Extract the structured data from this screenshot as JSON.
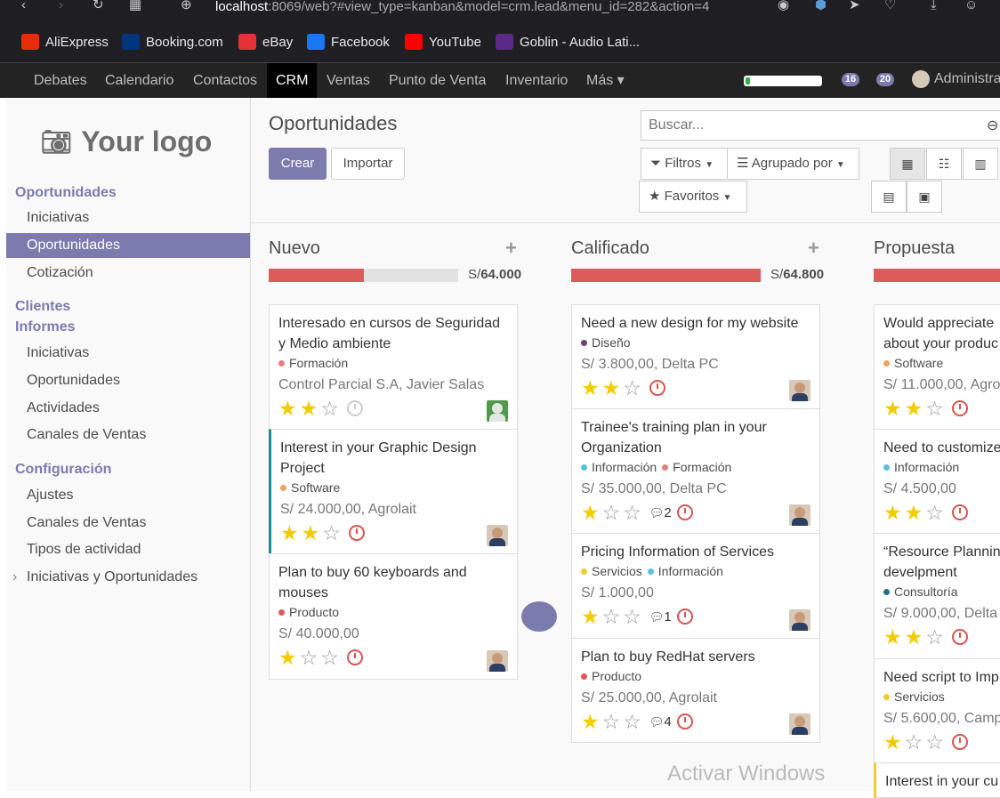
{
  "browser": {
    "url_host": "localhost",
    "url_rest": ":8069/web?#view_type=kanban&model=crm.lead&menu_id=282&action=4",
    "bookmarks": [
      {
        "label": "AliExpress",
        "icon": "aliexpress-icon",
        "color": "#e62e04"
      },
      {
        "label": "Booking.com",
        "icon": "booking-icon",
        "color": "#003580"
      },
      {
        "label": "eBay",
        "icon": "ebay-icon",
        "color": "#e53238"
      },
      {
        "label": "Facebook",
        "icon": "facebook-icon",
        "color": "#1877f2"
      },
      {
        "label": "YouTube",
        "icon": "youtube-icon",
        "color": "#ff0000"
      },
      {
        "label": "Goblin - Audio Lati...",
        "icon": "goblin-icon",
        "color": "#5b2a86"
      }
    ]
  },
  "topbar": {
    "menu": [
      "Debates",
      "Calendario",
      "Contactos",
      "CRM",
      "Ventas",
      "Punto de Venta",
      "Inventario",
      "Más"
    ],
    "active": "CRM",
    "progress": 0.06,
    "badge_activities": "16",
    "badge_messages": "20",
    "user": "Administra"
  },
  "sidebar": {
    "logo_text": "Your logo",
    "sections": [
      {
        "heading": "Oportunidades",
        "items": [
          "Iniciativas",
          "Oportunidades",
          "Cotización"
        ]
      },
      {
        "heading": "Clientes",
        "items": []
      },
      {
        "heading": "Informes",
        "items": [
          "Iniciativas",
          "Oportunidades",
          "Actividades",
          "Canales de Ventas"
        ]
      },
      {
        "heading": "Configuración",
        "items": [
          "Ajustes",
          "Canales de Ventas",
          "Tipos de actividad",
          "Iniciativas y Oportunidades"
        ]
      }
    ],
    "active_item": "Oportunidades"
  },
  "control": {
    "title": "Oportunidades",
    "create": "Crear",
    "import": "Importar",
    "search_placeholder": "Buscar...",
    "filters": "Filtros",
    "group_by": "Agrupado por",
    "favorites": "Favoritos"
  },
  "columns": [
    {
      "title": "Nuevo",
      "currency": "S/",
      "total": "64.000",
      "progress": 0.5,
      "cards": [
        {
          "title": "Interesado en cursos de Seguridad y Medio ambiente",
          "tags": [
            {
              "label": "Formación",
              "color": "#e87b7b"
            }
          ],
          "amount": "Control Parcial S.A, Javier Salas",
          "stars": 2,
          "clock": "grey",
          "messages": "",
          "avatar": "green",
          "accent": ""
        },
        {
          "title": "Interest in your Graphic Design Project",
          "tags": [
            {
              "label": "Software",
              "color": "#f0a35a"
            }
          ],
          "amount": "S/ 24.000,00, Agrolait",
          "stars": 2,
          "clock": "red",
          "messages": "",
          "avatar": "person",
          "accent": "teal"
        },
        {
          "title": "Plan to buy 60 keyboards and mouses",
          "tags": [
            {
              "label": "Producto",
              "color": "#e05555"
            }
          ],
          "amount": "S/ 40.000,00",
          "stars": 1,
          "clock": "red",
          "messages": "",
          "avatar": "person",
          "accent": ""
        }
      ]
    },
    {
      "title": "Calificado",
      "currency": "S/",
      "total": "64.800",
      "progress": 1.0,
      "cards": [
        {
          "title": "Need a new design for my website",
          "tags": [
            {
              "label": "Diseño",
              "color": "#6b3e6e"
            }
          ],
          "amount": "S/ 3.800,00, Delta PC",
          "stars": 2,
          "clock": "red",
          "messages": "",
          "avatar": "person",
          "accent": ""
        },
        {
          "title": "Trainee's training plan in your Organization",
          "tags": [
            {
              "label": "Información",
              "color": "#5bc0de"
            },
            {
              "label": "Formación",
              "color": "#e87b7b"
            }
          ],
          "amount": "S/ 35.000,00, Delta PC",
          "stars": 1,
          "clock": "red",
          "messages": "2",
          "avatar": "person",
          "accent": ""
        },
        {
          "title": "Pricing Information of Services",
          "tags": [
            {
              "label": "Servicios",
              "color": "#f1cc30"
            },
            {
              "label": "Información",
              "color": "#5bc0de"
            }
          ],
          "amount": "S/ 1.000,00",
          "stars": 1,
          "clock": "red",
          "messages": "1",
          "avatar": "person",
          "accent": ""
        },
        {
          "title": "Plan to buy RedHat servers",
          "tags": [
            {
              "label": "Producto",
              "color": "#e05555"
            }
          ],
          "amount": "S/ 25.000,00, Agrolait",
          "stars": 1,
          "clock": "red",
          "messages": "4",
          "avatar": "person",
          "accent": ""
        }
      ]
    },
    {
      "title": "Propuesta",
      "currency": "",
      "total": "",
      "progress": 1.0,
      "cards": [
        {
          "title": "Would appreciate about your produc",
          "tags": [
            {
              "label": "Software",
              "color": "#f0a35a"
            }
          ],
          "amount": "S/ 11.000,00, Agro",
          "stars": 2,
          "clock": "red",
          "messages": "",
          "avatar": "",
          "accent": ""
        },
        {
          "title": "Need to customize",
          "tags": [
            {
              "label": "Información",
              "color": "#5bc0de"
            }
          ],
          "amount": "S/ 4.500,00",
          "stars": 2,
          "clock": "red",
          "messages": "",
          "avatar": "",
          "accent": ""
        },
        {
          "title": "“Resource Plannin develpment",
          "tags": [
            {
              "label": "Consultoría",
              "color": "#1f6f8b"
            }
          ],
          "amount": "S/ 9.000,00, Delta",
          "stars": 2,
          "clock": "red",
          "messages": "",
          "avatar": "",
          "accent": ""
        },
        {
          "title": "Need script to Imp",
          "tags": [
            {
              "label": "Servicios",
              "color": "#f1cc30"
            }
          ],
          "amount": "S/ 5.600,00, Camp",
          "stars": 1,
          "clock": "red",
          "messages": "",
          "avatar": "",
          "accent": ""
        },
        {
          "title": "Interest in your cu",
          "tags": [],
          "amount": "",
          "stars": 0,
          "clock": "",
          "messages": "",
          "avatar": "",
          "accent": "yellow"
        }
      ]
    }
  ],
  "watermark": "Activar Windows"
}
